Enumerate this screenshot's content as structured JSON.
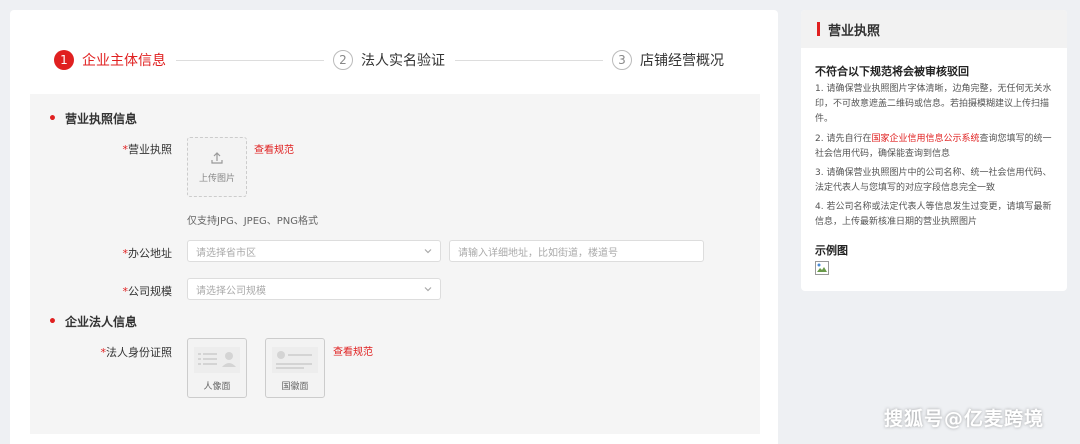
{
  "steps": [
    {
      "num": "1",
      "label": "企业主体信息",
      "state": "active"
    },
    {
      "num": "2",
      "label": "法人实名验证",
      "state": "inactive"
    },
    {
      "num": "3",
      "label": "店铺经营概况",
      "state": "inactive"
    }
  ],
  "sections": {
    "license": {
      "title": "营业执照信息"
    },
    "legal": {
      "title": "企业法人信息"
    }
  },
  "fields": {
    "license": {
      "label": "营业执照",
      "upload_text": "上传图片",
      "spec_link": "查看规范",
      "hint": "仅支持JPG、JPEG、PNG格式"
    },
    "address": {
      "label": "办公地址",
      "region_placeholder": "请选择省市区",
      "detail_placeholder": "请输入详细地址，比如街道，楼道号"
    },
    "scale": {
      "label": "公司规模",
      "placeholder": "请选择公司规模"
    },
    "id_card": {
      "label": "法人身份证照",
      "front_text": "人像面",
      "back_text": "国徽面",
      "spec_link": "查看规范"
    }
  },
  "side_panel": {
    "title": "营业执照",
    "heading": "不符合以下规范将会被审核驳回",
    "rules": {
      "r1": "1. 请确保营业执照图片字体清晰，边角完整，无任何无关水印，不可故意遮盖二维码或信息。若拍摄模糊建议上传扫描件。",
      "r2_prefix": "2. 请先自行在",
      "r2_link": "国家企业信用信息公示系统",
      "r2_suffix": "查询您填写的统一社会信用代码，确保能查询到信息",
      "r3": "3. 请确保营业执照图片中的公司名称、统一社会信用代码、法定代表人与您填写的对应字段信息完全一致",
      "r4": "4. 若公司名称或法定代表人等信息发生过变更，请填写最新信息，上传最新核准日期的营业执照图片"
    },
    "example_title": "示例图"
  },
  "watermark": "搜狐号@亿麦跨境",
  "colors": {
    "accent": "#e02020",
    "page_bg": "#eef0f3",
    "form_bg": "#f5f5f5"
  }
}
